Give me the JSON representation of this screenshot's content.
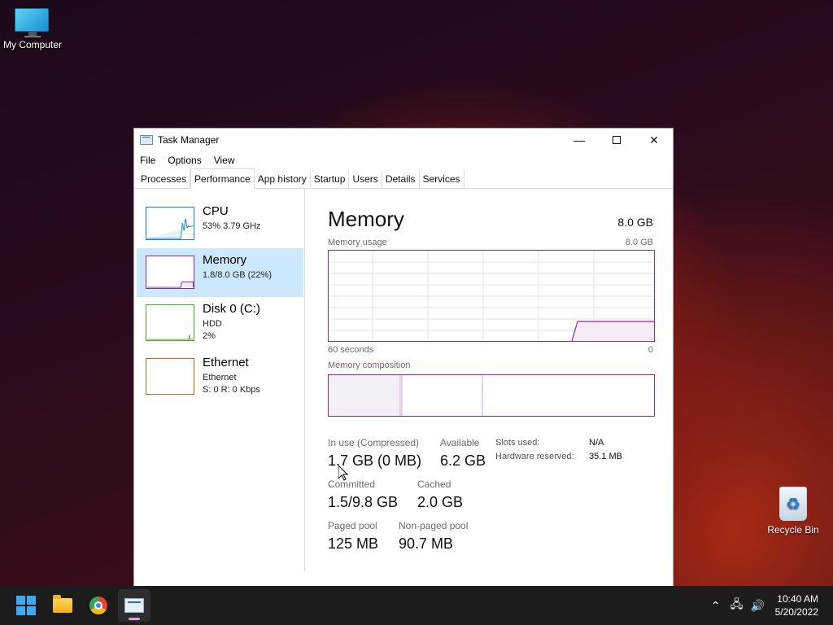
{
  "desktop": {
    "my_computer_label": "My Computer",
    "recycle_bin_label": "Recycle Bin"
  },
  "window": {
    "title": "Task Manager",
    "minimize_icon": "minimize-icon",
    "maximize_icon": "maximize-icon",
    "close_icon": "close-icon"
  },
  "menu": {
    "file": "File",
    "options": "Options",
    "view": "View"
  },
  "tabs": [
    "Processes",
    "Performance",
    "App history",
    "Startup",
    "Users",
    "Details",
    "Services"
  ],
  "sidebar": {
    "items": [
      {
        "name": "CPU",
        "lines": [
          "53% 3.79 GHz"
        ],
        "color": "#1783c7"
      },
      {
        "name": "Memory",
        "lines": [
          "1.8/8.0 GB (22%)"
        ],
        "color": "#8b2c9e"
      },
      {
        "name": "Disk 0 (C:)",
        "lines": [
          "HDD",
          "2%"
        ],
        "color": "#4da532"
      },
      {
        "name": "Ethernet",
        "lines": [
          "Ethernet",
          "S: 0 R: 0 Kbps"
        ],
        "color": "#a57524"
      }
    ]
  },
  "memory": {
    "title": "Memory",
    "total": "8.0 GB",
    "usage_label": "Memory usage",
    "usage_max": "8.0 GB",
    "axis_left": "60 seconds",
    "axis_right": "0",
    "composition_label": "Memory composition",
    "in_use_label": "In use (Compressed)",
    "in_use_value": "1.7 GB (0 MB)",
    "available_label": "Available",
    "available_value": "6.2 GB",
    "committed_label": "Committed",
    "committed_value": "1.5/9.8 GB",
    "cached_label": "Cached",
    "cached_value": "2.0 GB",
    "paged_label": "Paged pool",
    "paged_value": "125 MB",
    "nonpaged_label": "Non-paged pool",
    "nonpaged_value": "90.7 MB",
    "slots_label": "Slots used:",
    "slots_value": "N/A",
    "hw_label": "Hardware reserved:",
    "hw_value": "35.1 MB",
    "accent_color": "#8b2c9e"
  },
  "taskbar": {
    "time": "10:40 AM",
    "date": "5/20/2022"
  }
}
